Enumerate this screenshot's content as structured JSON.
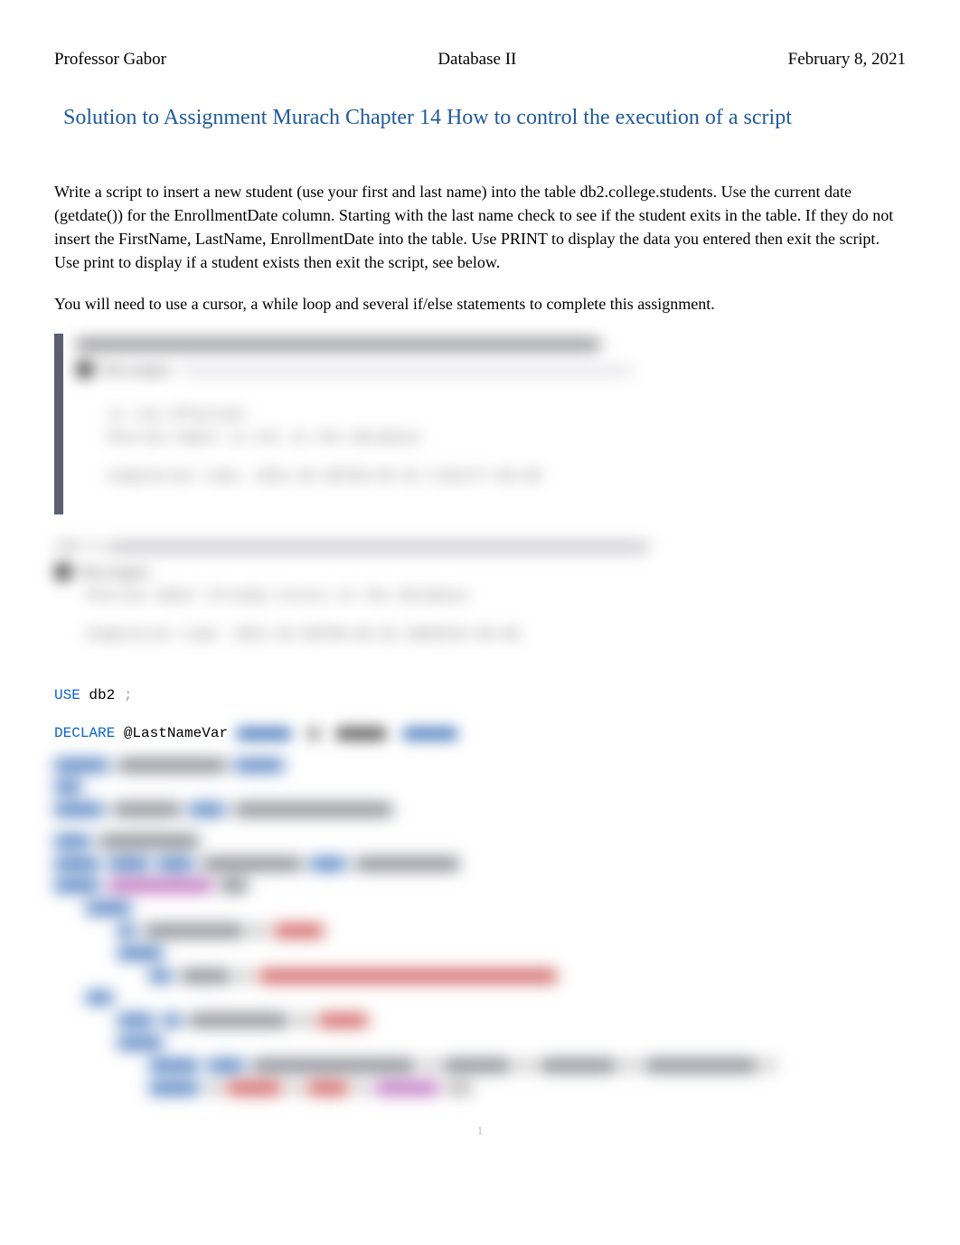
{
  "header": {
    "left": "Professor Gabor",
    "center": "Database II",
    "right": "February 8, 2021"
  },
  "title": "Solution to Assignment Murach Chapter 14 How to control the execution of a script",
  "paragraphs": {
    "p1": "Write a script to insert a new student (use your first and last name) into the table db2.college.students. Use the current date (getdate()) for the EnrollmentDate column. Starting with the last name check to see if the student exits in the table. If they do not insert the FirstName, LastName, EnrollmentDate into the table. Use PRINT to display the data you entered then exit the script. Use print to display if a student exists then exit the script, see below.",
    "p2": "You will need to use a cursor, a while loop and several if/else statements to complete this assignment."
  },
  "code": {
    "use_kw": "USE",
    "use_db": " db2 ",
    "semicolon": ";",
    "declare_kw": "DECLARE",
    "declare_var": " @LastNameVar    "
  },
  "blurred": {
    "block1": {
      "l1": "(1 row affected)",
      "l2": "Peurian Gabor is not in the database",
      "l3": "Completion time: 2021-02-08T00:04:32.7222177-05:00"
    },
    "block2": {
      "l1": "Peurian Gabor Already exists in the database",
      "l2": "Completion time: 2021-02-08T00:05:01.8984543-05:00"
    }
  },
  "pagenum": "1"
}
